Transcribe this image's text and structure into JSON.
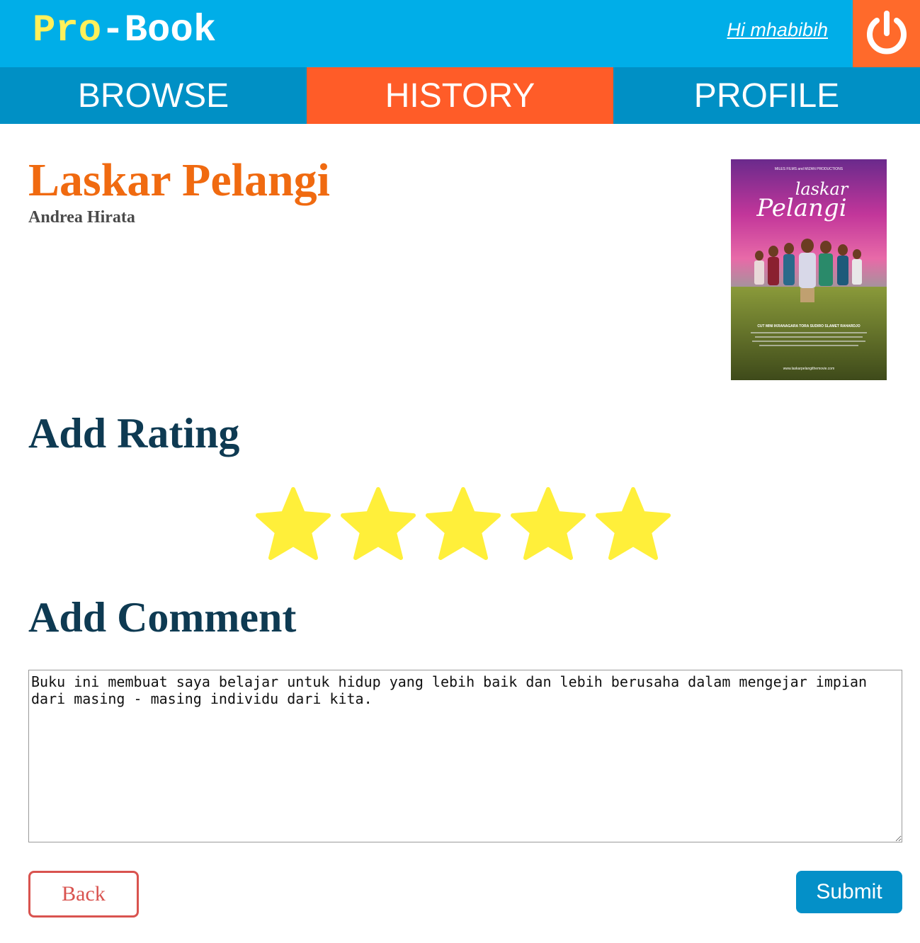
{
  "header": {
    "logo_pro": "Pro",
    "logo_rest": "-Book",
    "greeting": "Hi mhabibih",
    "logout_icon": "power-icon",
    "brand_color": "#00aee8",
    "accent_color": "#ff5c28"
  },
  "nav": {
    "tabs": [
      {
        "label": "BROWSE",
        "active": false
      },
      {
        "label": "HISTORY",
        "active": true
      },
      {
        "label": "PROFILE",
        "active": false
      }
    ]
  },
  "book": {
    "title": "Laskar Pelangi",
    "author": "Andrea Hirata",
    "cover": {
      "top_credit": "MILES FILMS and MIZAN PRODUCTIONS",
      "title_line1": "laskar",
      "title_line2": "Pelangi",
      "cast": "CUT MINI   IKRANAGARA   TORA SUDIRO   SLAMET RAHARDJO",
      "website": "www.laskarpelangithemovie.com"
    }
  },
  "rating": {
    "heading": "Add Rating",
    "value": 5,
    "max": 5,
    "star_color": "#ffef3a",
    "icon": "star-icon"
  },
  "comment": {
    "heading": "Add Comment",
    "text": "Buku ini membuat saya belajar untuk hidup yang lebih baik dan lebih berusaha dalam mengejar impian dari masing - masing individu dari kita."
  },
  "actions": {
    "back_label": "Back",
    "submit_label": "Submit"
  }
}
